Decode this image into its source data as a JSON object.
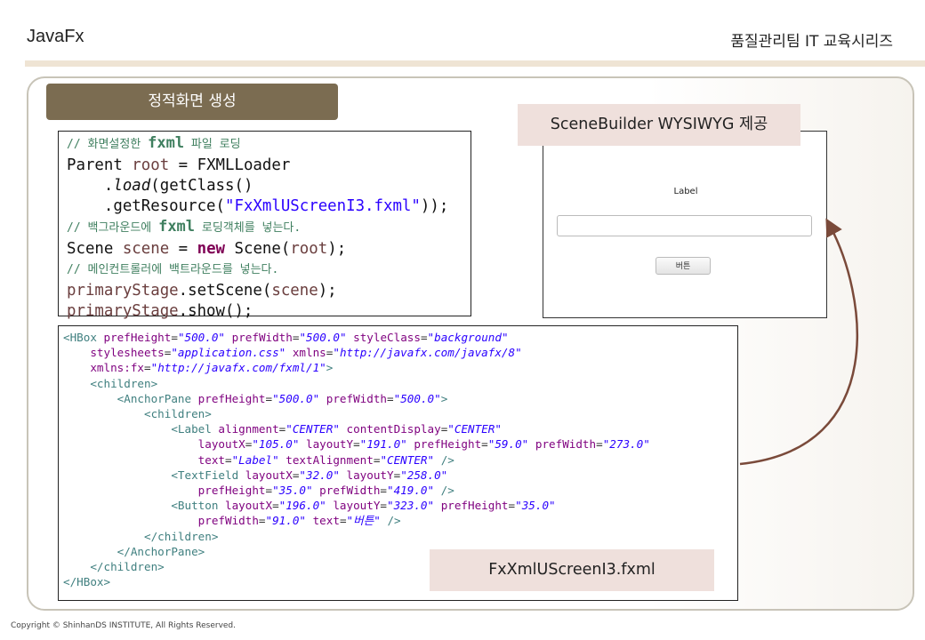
{
  "header": {
    "left": "JavaFx",
    "right": "품질관리팀 IT 교육시리즈"
  },
  "title_tab": "정적화면 생성",
  "java_code": {
    "l1": {
      "slash": "// ",
      "c1": "화면설정한 ",
      "k": "fxml",
      "c2": " 파일 로딩"
    },
    "l2": {
      "a": "Parent ",
      "v": "root",
      "b": " = FXMLLoader"
    },
    "l3": {
      "indent": "    .",
      "m": "load",
      "b": "(getClass()"
    },
    "l4": {
      "a": "    .getResource(",
      "s": "\"FxXmlUScreenI3.fxml\"",
      "b": "));"
    },
    "l5": {
      "slash": "// ",
      "c1": "백그라운드에 ",
      "k": "fxml",
      "c2": " 로딩객체를 넣는다."
    },
    "l6": {
      "a": "Scene ",
      "v": "scene",
      "b": " = ",
      "kw": "new",
      "c": " Scene(",
      "v2": "root",
      "d": ");"
    },
    "l7": {
      "slash": "// ",
      "c1": "메인컨트롤러에 백트라운드를 넣는다."
    },
    "l8": {
      "v": "primaryStage",
      "a": ".setScene(",
      "v2": "scene",
      "b": ");"
    },
    "l9": {
      "v": "primaryStage",
      "a": ".show();"
    }
  },
  "xml": {
    "hbox_open": "<HBox",
    "a_prefHeight": "prefHeight",
    "v_500": "\"500.0\"",
    "a_prefWidth": "prefWidth",
    "a_styleClass": "styleClass",
    "v_background": "\"background\"",
    "a_stylesheets": "stylesheets",
    "v_appcss": "\"application.css\"",
    "a_xmlns": "xmlns",
    "v_xmlns": "\"http://javafx.com/javafx/8\"",
    "a_xmlnsfx": "xmlns:fx",
    "v_xmlnsfx": "\"http://javafx.com/fxml/1\"",
    "gt": ">",
    "children_open": "<children>",
    "anchor_open": "<AnchorPane",
    "label_open": "<Label",
    "a_alignment": "alignment",
    "v_center": "\"CENTER\"",
    "a_contentDisplay": "contentDisplay",
    "a_layoutX": "layoutX",
    "a_layoutY": "layoutY",
    "v_105": "\"105.0\"",
    "v_191": "\"191.0\"",
    "v_59": "\"59.0\"",
    "v_273": "\"273.0\"",
    "a_text": "text",
    "v_label": "\"Label\"",
    "a_textAlignment": "textAlignment",
    "selfclose": " />",
    "textfield_open": "<TextField",
    "v_32": "\"32.0\"",
    "v_258": "\"258.0\"",
    "v_35": "\"35.0\"",
    "v_419": "\"419.0\"",
    "button_open": "<Button",
    "v_196": "\"196.0\"",
    "v_323": "\"323.0\"",
    "v_91": "\"91.0\"",
    "v_btntext": "\"버튼\"",
    "children_close": "</children>",
    "anchor_close": "</AnchorPane>",
    "hbox_close": "</HBox>"
  },
  "preview": {
    "label": "Label",
    "button": "버튼"
  },
  "scenebuilder_tag": "SceneBuilder  WYSIWYG 제공",
  "file_tag": "FxXmlUScreenI3.fxml",
  "footer": "Copyright © ShinhanDS INSTITUTE, All Rights Reserved.",
  "colors": {
    "accent_bar": "#efe4d4",
    "title_tab": "#7b6c51",
    "callout": "#efe0dc",
    "arrow": "#7a4a3a"
  }
}
